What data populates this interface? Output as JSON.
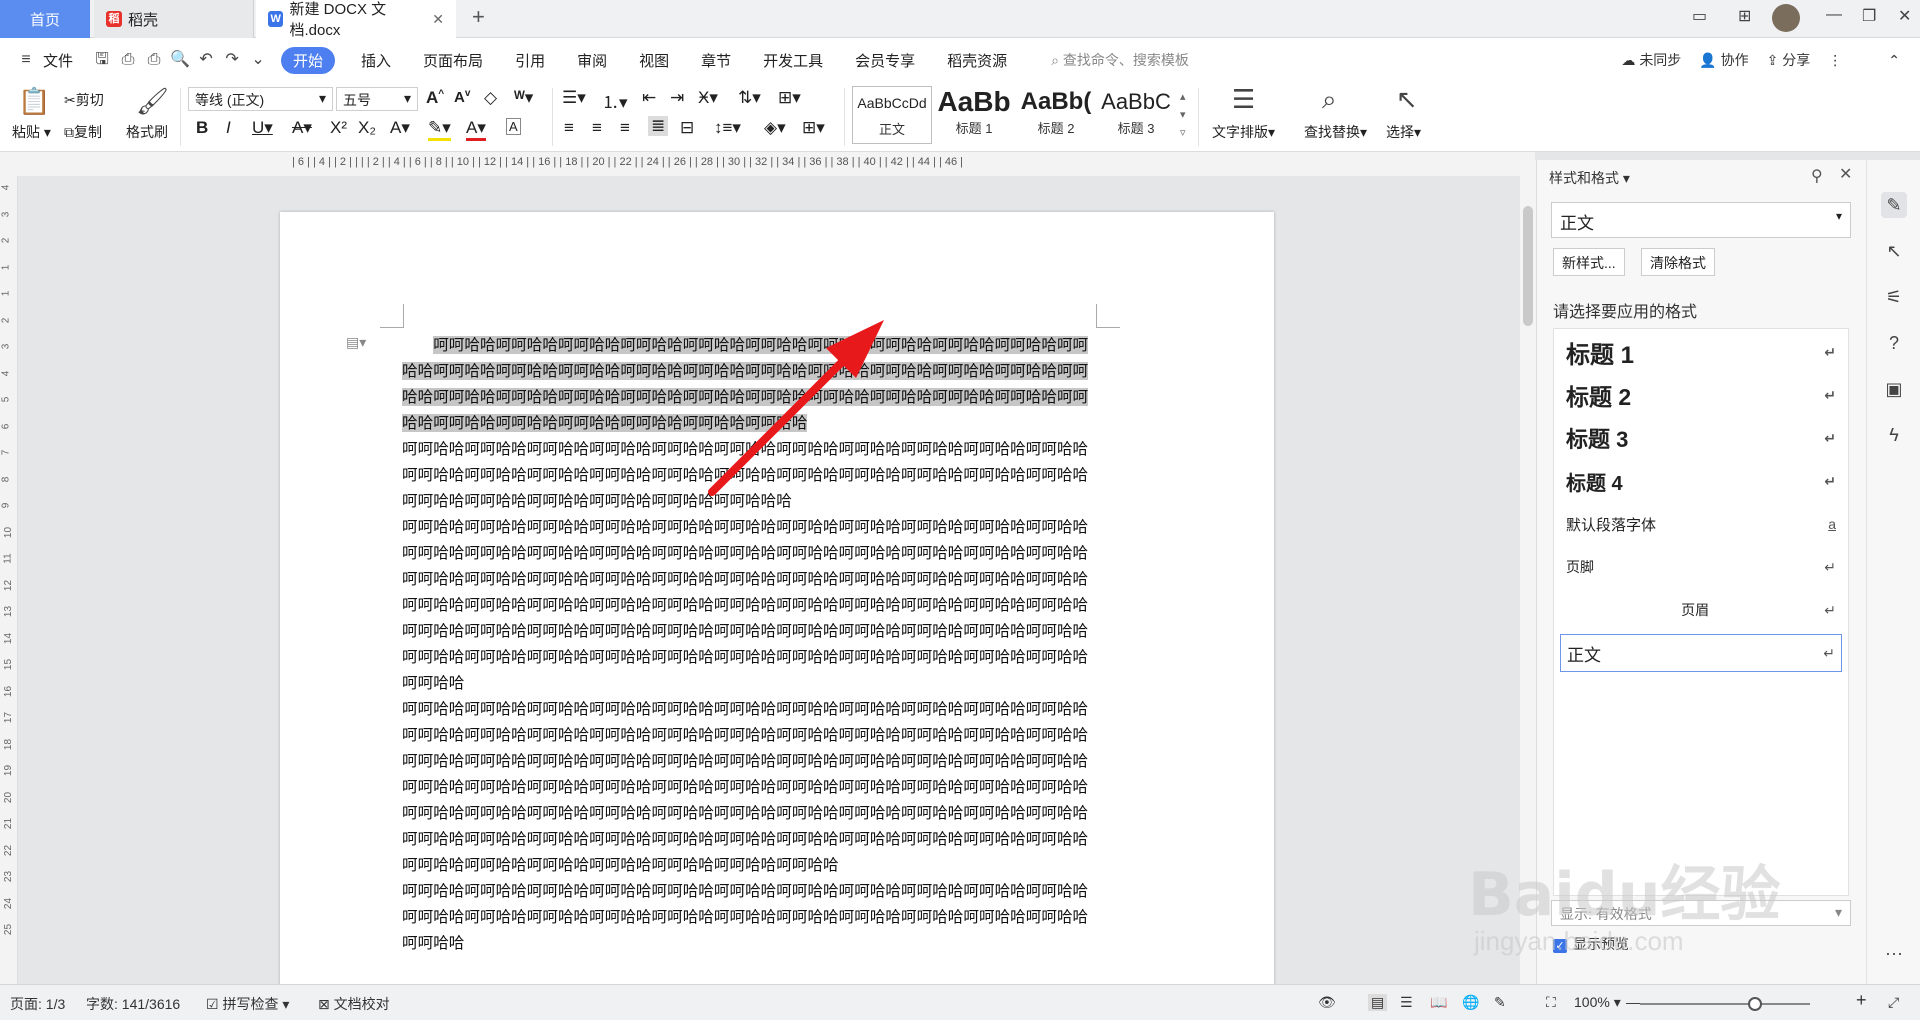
{
  "tabs": {
    "home": "首页",
    "daoke": "稻壳",
    "doc": "新建 DOCX 文档.docx"
  },
  "menu": {
    "file": "文件",
    "items": [
      "开始",
      "插入",
      "页面布局",
      "引用",
      "审阅",
      "视图",
      "章节",
      "开发工具",
      "会员专享",
      "稻壳资源"
    ],
    "search": "查找命令、搜索模板",
    "sync": "未同步",
    "collab": "协作",
    "share": "分享"
  },
  "ribbon": {
    "paste": "粘贴",
    "cut": "剪切",
    "copy": "复制",
    "format_painter": "格式刷",
    "font": "等线 (正文)",
    "size": "五号",
    "styles": [
      {
        "sample": "AaBbCcDd",
        "name": "正文"
      },
      {
        "sample": "AaBb",
        "name": "标题 1"
      },
      {
        "sample": "AaBb(",
        "name": "标题 2"
      },
      {
        "sample": "AaBbC",
        "name": "标题 3"
      }
    ],
    "text_layout": "文字排版",
    "find_replace": "查找替换",
    "select": "选择"
  },
  "ruler": "| 6 |  | 4 |  | 2 |  |  |  | 2 |  | 4 |  | 6 |  | 8 |  | 10 |  | 12 |  | 14 |  | 16 |  | 18 |  | 20 |  | 22 |  | 24 |  | 26 |  | 28 |  | 30 |  | 32 |  | 34 |  | 36 |  | 38 |  | 40 |  | 42 |  | 44 |  | 46 |",
  "vruler": [
    "4",
    "3",
    "2",
    "1",
    "1",
    "2",
    "3",
    "4",
    "5",
    "6",
    "7",
    "8",
    "9",
    "10",
    "11",
    "12",
    "13",
    "14",
    "15",
    "16",
    "17",
    "18",
    "19",
    "20",
    "21",
    "22",
    "23",
    "24",
    "25"
  ],
  "document": {
    "paragraphs": [
      {
        "text": "呵呵哈哈呵呵哈哈呵呵哈哈呵呵哈哈呵呵哈哈呵呵哈哈呵呵哈哈呵呵哈哈呵呵哈哈呵呵哈哈呵呵哈哈呵呵哈哈呵呵哈哈呵呵哈哈呵呵哈哈呵呵哈哈呵呵哈哈呵呵哈哈呵呵哈哈呵呵哈哈呵呵哈哈呵呵哈哈呵呵哈哈呵呵哈哈呵呵哈哈呵呵哈哈呵呵哈哈呵呵哈哈呵呵哈哈呵呵哈哈呵呵哈哈呵呵哈哈呵呵哈哈呵呵哈哈呵呵哈哈呵呵哈哈呵呵哈哈呵呵哈哈呵呵哈哈",
        "highlight": true
      },
      {
        "text": "呵呵哈哈呵呵哈哈呵呵哈哈呵呵哈哈呵呵哈哈呵呵哈哈呵呵哈哈呵呵哈哈呵呵哈哈呵呵哈哈呵呵哈哈呵呵哈哈呵呵哈哈呵呵哈哈呵呵哈哈呵呵哈哈呵呵哈哈呵呵哈哈呵呵哈哈呵呵哈哈呵呵哈哈呵呵哈哈呵呵哈哈呵呵哈哈呵呵哈哈呵呵哈哈呵呵哈哈呵呵哈哈哈",
        "highlight": false
      },
      {
        "text": "呵呵哈哈呵呵哈哈呵呵哈哈呵呵哈哈呵呵哈哈呵呵哈哈呵呵哈哈呵呵哈哈呵呵哈哈呵呵哈哈呵呵哈哈呵呵哈哈呵呵哈哈呵呵哈哈呵呵哈哈呵呵哈哈呵呵哈哈呵呵哈哈呵呵哈哈呵呵哈哈呵呵哈哈呵呵哈哈呵呵哈哈呵呵哈哈呵呵哈哈呵呵哈哈呵呵哈哈呵呵哈哈呵呵哈哈呵呵哈哈呵呵哈哈呵呵哈哈呵呵哈哈呵呵哈哈呵呵哈哈呵呵哈哈呵呵哈哈呵呵哈哈呵呵哈哈呵呵哈哈呵呵哈哈呵呵哈哈呵呵哈哈呵呵哈哈呵呵哈哈呵呵哈哈呵呵哈哈呵呵哈哈呵呵哈哈呵呵哈哈呵呵哈哈呵呵哈哈呵呵哈哈呵呵哈哈呵呵哈哈呵呵哈哈呵呵哈哈呵呵哈哈呵呵哈哈呵呵哈哈呵呵哈哈呵呵哈哈呵呵哈哈呵呵哈哈呵呵哈哈呵呵哈哈呵呵哈哈",
        "highlight": false
      },
      {
        "text": "呵呵哈哈呵呵哈哈呵呵哈哈呵呵哈哈呵呵哈哈呵呵哈哈呵呵哈哈呵呵哈哈呵呵哈哈呵呵哈哈呵呵哈哈呵呵哈哈呵呵哈哈呵呵哈哈呵呵哈哈呵呵哈哈呵呵哈哈呵呵哈哈呵呵哈哈呵呵哈哈呵呵哈哈呵呵哈哈呵呵哈哈呵呵哈哈呵呵哈哈呵呵哈哈呵呵哈哈呵呵哈哈呵呵哈哈呵呵哈哈呵呵哈哈呵呵哈哈呵呵哈哈呵呵哈哈呵呵哈哈呵呵哈哈呵呵哈哈呵呵哈哈呵呵哈哈呵呵哈哈呵呵哈哈呵呵哈哈呵呵哈哈呵呵哈哈呵呵哈哈呵呵哈哈呵呵哈哈呵呵哈哈呵呵哈哈呵呵哈哈呵呵哈哈呵呵哈哈呵呵哈哈呵呵哈哈呵呵哈哈呵呵哈哈呵呵哈哈呵呵哈哈呵呵哈哈呵呵哈哈呵呵哈哈呵呵哈哈呵呵哈哈呵呵哈哈呵呵哈哈呵呵哈哈呵呵哈哈呵呵哈哈呵呵哈哈呵呵哈哈呵呵哈哈呵呵哈哈呵呵哈哈",
        "highlight": false
      },
      {
        "text": "呵呵哈哈呵呵哈哈呵呵哈哈呵呵哈哈呵呵哈哈呵呵哈哈呵呵哈哈呵呵哈哈呵呵哈哈呵呵哈哈呵呵哈哈呵呵哈哈呵呵哈哈呵呵哈哈呵呵哈哈呵呵哈哈呵呵哈哈呵呵哈哈呵呵哈哈呵呵哈哈呵呵哈哈呵呵哈哈呵呵哈哈",
        "highlight": false
      }
    ]
  },
  "panel": {
    "title": "样式和格式",
    "current_style": "正文",
    "new_style": "新样式...",
    "clear_format": "清除格式",
    "choose_label": "请选择要应用的格式",
    "styles": [
      {
        "name": "标题  1",
        "mark": "↵"
      },
      {
        "name": "标题  2",
        "mark": "↵"
      },
      {
        "name": "标题  3",
        "mark": "↵"
      },
      {
        "name": "标题  4",
        "mark": "↵"
      },
      {
        "name": "默认段落字体",
        "mark": "a"
      },
      {
        "name": "页脚",
        "mark": "↵"
      },
      {
        "name": "页眉",
        "mark": "↵"
      },
      {
        "name": "正文",
        "mark": "↵"
      }
    ],
    "show": "显示: 有效格式",
    "preview": "显示预览"
  },
  "status": {
    "page": "页面: 1/3",
    "words": "字数: 141/3616",
    "spell": "拼写检查",
    "proof": "文档校对",
    "zoom": "100%"
  },
  "watermark": {
    "main": "Baidu经验",
    "sub": "jingyan.baidu.com"
  },
  "colors": {
    "accent": "#4e7ff0",
    "arrow": "#e8191b"
  }
}
